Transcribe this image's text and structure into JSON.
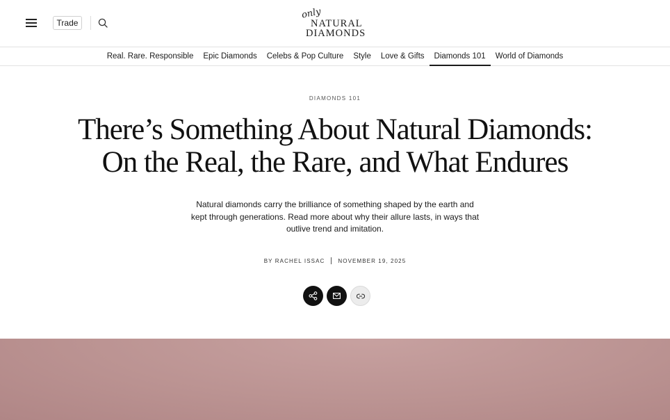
{
  "header": {
    "trade_label": "Trade",
    "logo": {
      "script": "only",
      "line1": "NATURAL",
      "line2": "DIAMONDS"
    }
  },
  "nav": {
    "items": [
      {
        "label": "Real. Rare. Responsible"
      },
      {
        "label": "Epic Diamonds"
      },
      {
        "label": "Celebs & Pop Culture"
      },
      {
        "label": "Style"
      },
      {
        "label": "Love & Gifts"
      },
      {
        "label": "Diamonds 101",
        "active": true
      },
      {
        "label": "World of Diamonds"
      }
    ]
  },
  "article": {
    "kicker": "DIAMONDS 101",
    "title_line1": "There’s Something About Natural Diamonds:",
    "title_line2": "On the Real, the Rare, and What Endures",
    "dek": "Natural diamonds carry the brilliance of something shaped by the earth and kept through generations. Read more about why their allure lasts, in ways that outlive trend and imitation.",
    "author": "BY RACHEL ISSAC",
    "date": "NOVEMBER 19, 2025"
  },
  "share": {
    "icons": [
      "share-icon",
      "mail-icon",
      "link-icon"
    ]
  },
  "colors": {
    "hero": "#bb9392",
    "share_dark": "#111111",
    "share_light": "#ececec"
  }
}
